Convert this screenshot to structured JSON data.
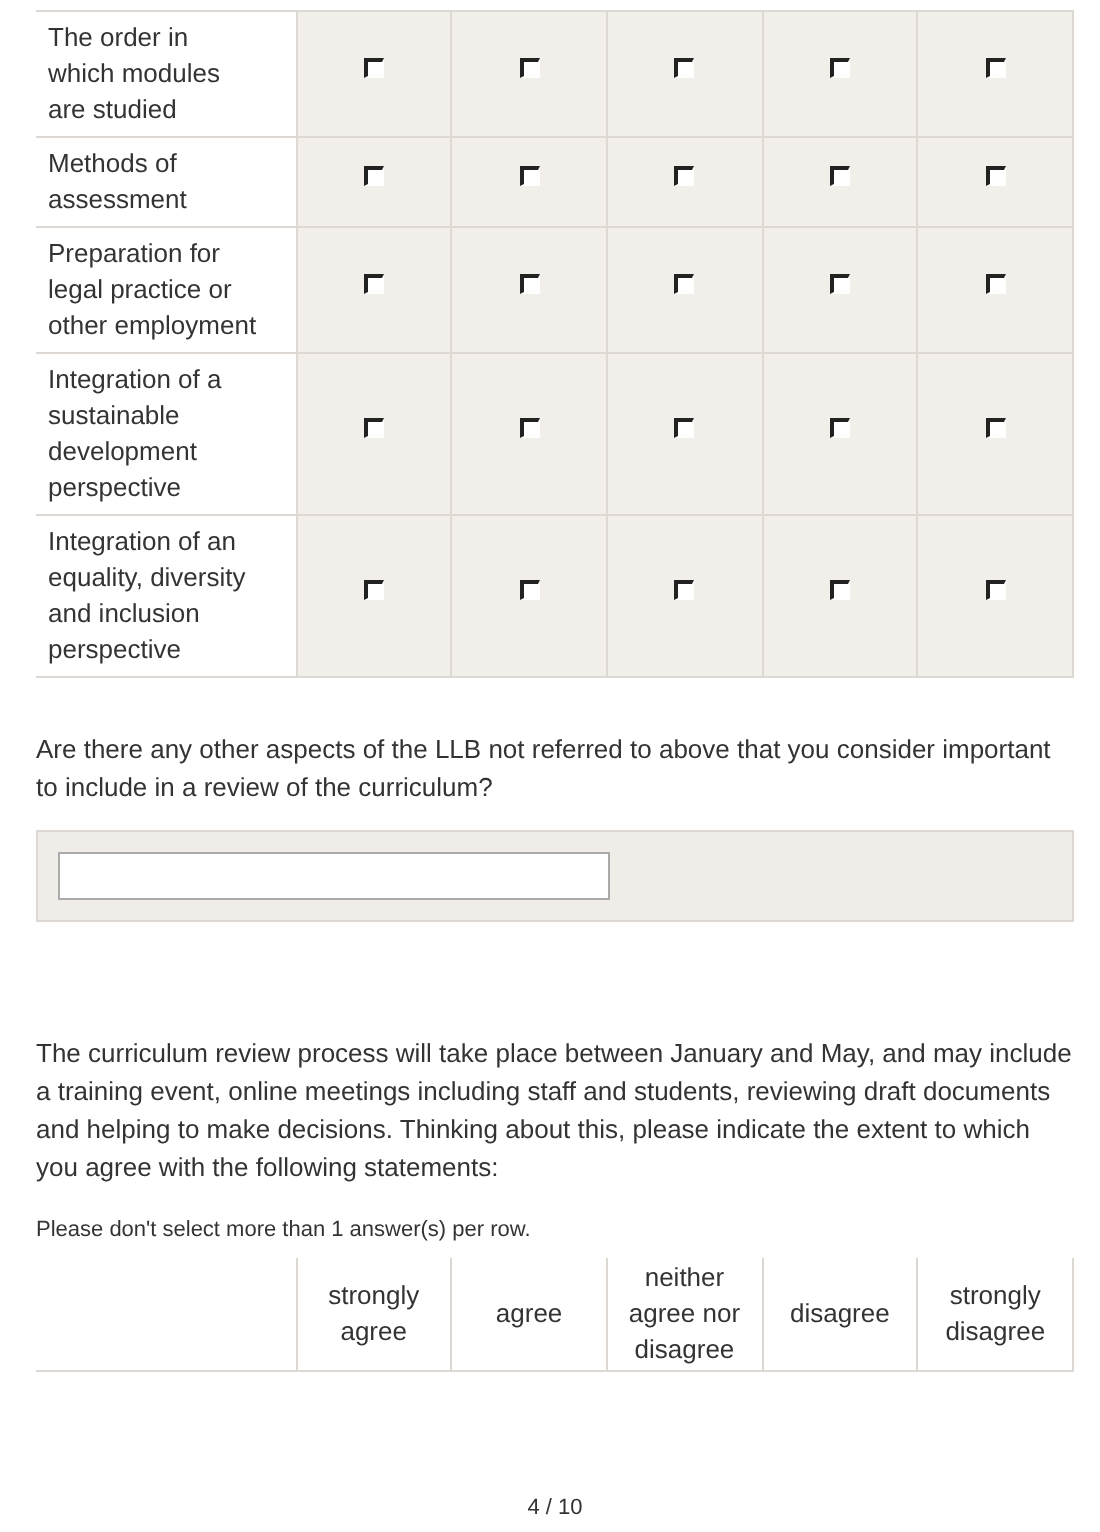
{
  "grid_1": {
    "rows": [
      {
        "label": "The order in which modules are studied",
        "options": [
          {
            "checked": false
          },
          {
            "checked": false
          },
          {
            "checked": false
          },
          {
            "checked": false
          },
          {
            "checked": false
          }
        ]
      },
      {
        "label": "Methods of assessment",
        "options": [
          {
            "checked": false
          },
          {
            "checked": false
          },
          {
            "checked": false
          },
          {
            "checked": false
          },
          {
            "checked": false
          }
        ]
      },
      {
        "label": "Preparation for legal practice or other employment",
        "options": [
          {
            "checked": false
          },
          {
            "checked": false
          },
          {
            "checked": false
          },
          {
            "checked": false
          },
          {
            "checked": false
          }
        ]
      },
      {
        "label": "Integration of a sustainable development perspective",
        "options": [
          {
            "checked": false
          },
          {
            "checked": false
          },
          {
            "checked": false
          },
          {
            "checked": false
          },
          {
            "checked": false
          }
        ]
      },
      {
        "label": "Integration of an equality, diversity and inclusion perspective",
        "options": [
          {
            "checked": false
          },
          {
            "checked": false
          },
          {
            "checked": false
          },
          {
            "checked": false
          },
          {
            "checked": false
          }
        ]
      }
    ]
  },
  "question": "Are there any other aspects of the LLB not referred to above that you consider important to include in a review of the curriculum?",
  "intro": "The curriculum review process will take place between January and May, and may include a training event, online meetings including staff and students, reviewing draft documents and helping to make decisions. Thinking about this, please indicate the extent to which you agree with the following statements:",
  "note": "Please don't select more than 1 answer(s) per row.",
  "grid_2": {
    "columns": [
      "strongly agree",
      "agree",
      "neither agree nor disagree",
      "disagree",
      "strongly disagree"
    ]
  },
  "page_indicator": "4 / 10"
}
